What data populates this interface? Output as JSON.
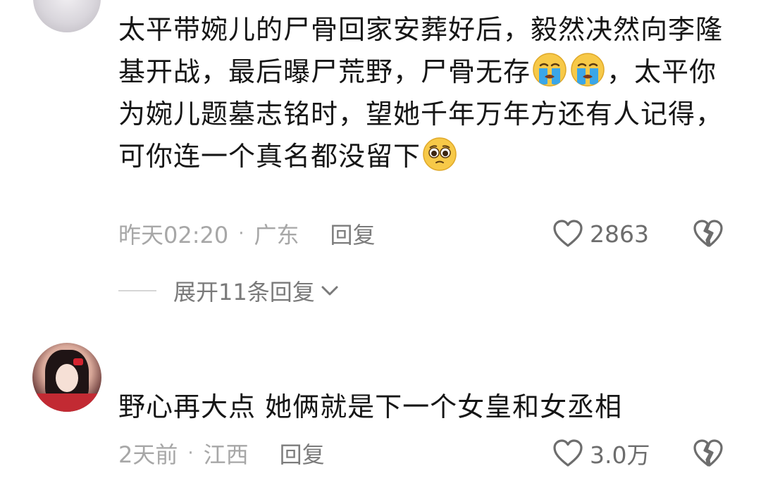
{
  "comments": [
    {
      "text_parts": [
        "太平带婉儿的尸骨回家安葬好后，毅然决然向李隆基开战，最后曝尸荒野，尸骨无存",
        "，太平你为婉儿题墓志铭时，望她千年万年方还有人记得，可你连一个真名都没留下"
      ],
      "emojis": [
        "crying-face-emoji",
        "crying-face-emoji",
        "pleading-face-emoji"
      ],
      "time": "昨天02:20",
      "separator": "·",
      "location": "广东",
      "reply_label": "回复",
      "likes": "2863",
      "expand_label": "展开11条回复"
    },
    {
      "text": "野心再大点 她俩就是下一个女皇和女丞相",
      "time": "2天前",
      "separator": "·",
      "location": "江西",
      "reply_label": "回复",
      "likes": "3.0万"
    }
  ],
  "colors": {
    "text": "#161616",
    "meta": "#a7a7a7",
    "reply": "#7c7c7c",
    "icon": "#6d6d6d"
  }
}
